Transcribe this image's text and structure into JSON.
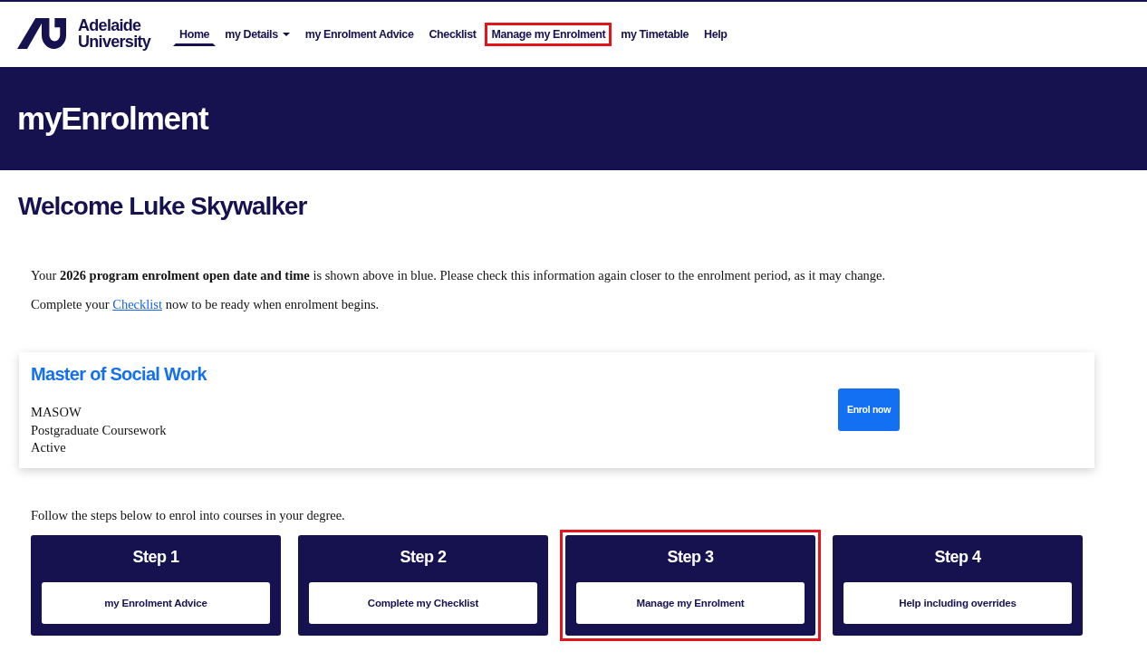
{
  "logo": {
    "line_1": "Adelaide",
    "line_2": "University"
  },
  "nav": [
    {
      "label": "Home",
      "kind": "link",
      "selected": true,
      "highlighted": false
    },
    {
      "label": "my Details",
      "kind": "dropdown",
      "selected": false,
      "highlighted": false
    },
    {
      "label": "my Enrolment Advice",
      "kind": "link",
      "selected": false,
      "highlighted": false
    },
    {
      "label": "Checklist",
      "kind": "link",
      "selected": false,
      "highlighted": false
    },
    {
      "label": "Manage my Enrolment",
      "kind": "link",
      "selected": false,
      "highlighted": true
    },
    {
      "label": "my Timetable",
      "kind": "link",
      "selected": false,
      "highlighted": false
    },
    {
      "label": "Help",
      "kind": "link",
      "selected": false,
      "highlighted": false
    }
  ],
  "banner": {
    "title": "myEnrolment"
  },
  "welcome": "Welcome Luke Skywalker",
  "notice": "Your **2026 program enrolment open date and time** is shown above in blue. Please check this information again closer to the enrolment period, as it may change.",
  "checklist_prompt": {
    "before": "Complete your",
    "link": "Checklist",
    "after": "now to be ready when enrolment begins."
  },
  "program": {
    "title": "Master of Social Work",
    "details": [
      "MASOW",
      "Postgraduate Coursework",
      "Active"
    ],
    "button": "Enrol now"
  },
  "steps_intro": "Follow the steps below to enrol into courses in your degree.",
  "steps": [
    {
      "title": "Step 1",
      "button": "my Enrolment Advice",
      "highlighted": false
    },
    {
      "title": "Step 2",
      "button": "Complete my Checklist",
      "highlighted": false
    },
    {
      "title": "Step 3",
      "button": "Manage my Enrolment",
      "highlighted": true
    },
    {
      "title": "Step 4",
      "button": "Help including overrides",
      "highlighted": false
    }
  ]
}
